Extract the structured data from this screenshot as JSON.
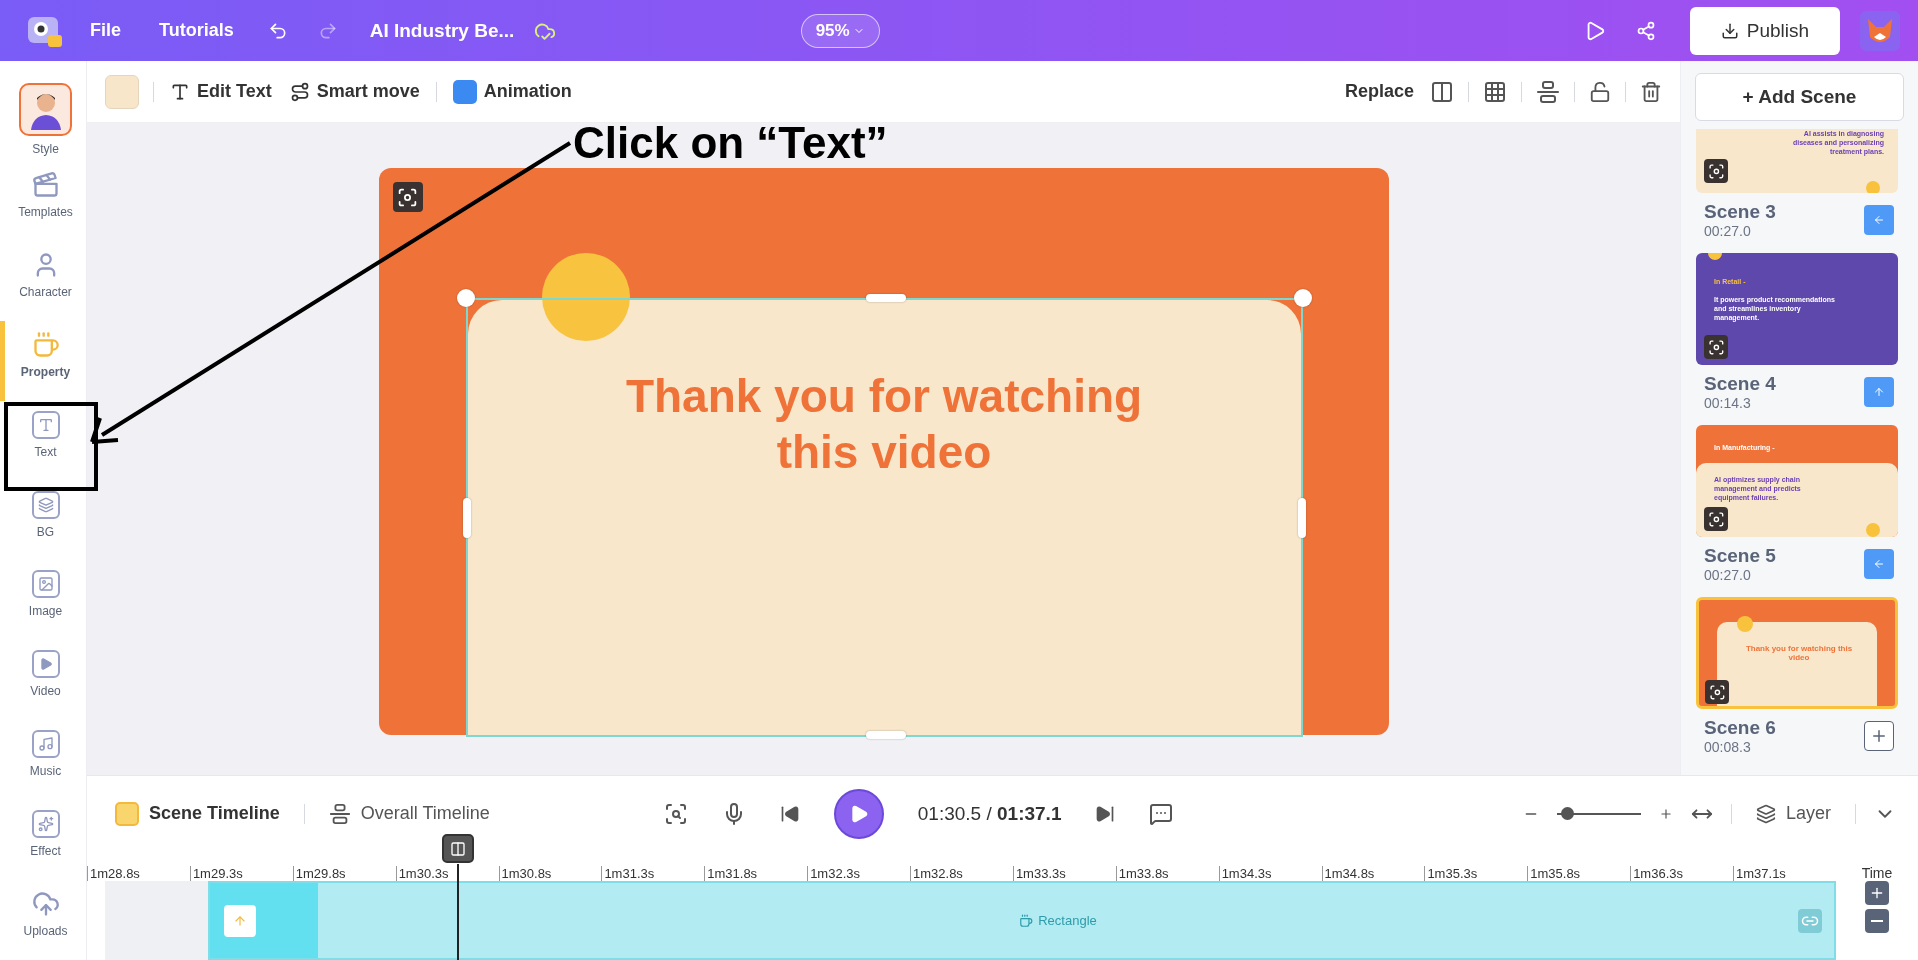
{
  "app_bar": {
    "menu": [
      "File",
      "Tutorials"
    ],
    "project_title": "AI Industry Be...",
    "zoom": "95%",
    "publish": "Publish"
  },
  "sidebar": {
    "items": [
      {
        "label": "Style",
        "kind": "avatar",
        "selected": false
      },
      {
        "label": "Templates",
        "kind": "templates",
        "selected": false
      },
      {
        "label": "Character",
        "kind": "character",
        "selected": false
      },
      {
        "label": "Property",
        "kind": "property",
        "selected": true
      },
      {
        "label": "Text",
        "kind": "text",
        "selected": false
      },
      {
        "label": "BG",
        "kind": "bg",
        "selected": false
      },
      {
        "label": "Image",
        "kind": "image",
        "selected": false
      },
      {
        "label": "Video",
        "kind": "video",
        "selected": false
      },
      {
        "label": "Music",
        "kind": "music",
        "selected": false
      },
      {
        "label": "Effect",
        "kind": "effect",
        "selected": false
      },
      {
        "label": "Uploads",
        "kind": "uploads",
        "selected": false
      }
    ]
  },
  "toolbar": {
    "edit_text": "Edit Text",
    "smart_move": "Smart move",
    "animation": "Animation",
    "replace": "Replace"
  },
  "canvas": {
    "heading": "Thank you for watching this video"
  },
  "annotation": {
    "text": "Click on “Text”"
  },
  "scenes": {
    "add_button": "+ Add Scene",
    "items": [
      {
        "name": "Scene 3",
        "duration": "00:27.0",
        "selected": false,
        "transition": {
          "kind": "left"
        },
        "thumb": {
          "kind": "cream",
          "body": "AI assists in diagnosing diseases and personalizing treatment plans."
        }
      },
      {
        "name": "Scene 4",
        "duration": "00:14.3",
        "selected": false,
        "transition": {
          "kind": "up"
        },
        "thumb": {
          "kind": "purple",
          "title": "In Retail -",
          "body": "It powers product recommendations and streamlines inventory management."
        }
      },
      {
        "name": "Scene 5",
        "duration": "00:27.0",
        "selected": false,
        "transition": {
          "kind": "left"
        },
        "thumb": {
          "kind": "split",
          "title": "In Manufacturing -",
          "body": "AI optimizes supply chain management and predicts equipment failures."
        }
      },
      {
        "name": "Scene 6",
        "duration": "00:08.3",
        "selected": true,
        "transition": {
          "kind": "add"
        },
        "thumb": {
          "kind": "framed",
          "body": "Thank you for watching this video"
        }
      }
    ]
  },
  "timeline": {
    "tabs": [
      {
        "label": "Scene Timeline",
        "selected": true
      },
      {
        "label": "Overall Timeline",
        "selected": false
      }
    ],
    "time": "01:30.5 / **01:37.1**",
    "zoom": {
      "level": 0.12
    },
    "layer": "Layer",
    "ticks": [
      "1m28.8s",
      "1m29.3s",
      "1m29.8s",
      "1m30.3s",
      "1m30.8s",
      "1m31.3s",
      "1m31.8s",
      "1m32.3s",
      "1m32.8s",
      "1m33.3s",
      "1m33.8s",
      "1m34.3s",
      "1m34.8s",
      "1m35.3s",
      "1m35.8s",
      "1m36.3s",
      "1m37.1s"
    ],
    "track_label": "Rectangle",
    "time_label": "Time"
  }
}
